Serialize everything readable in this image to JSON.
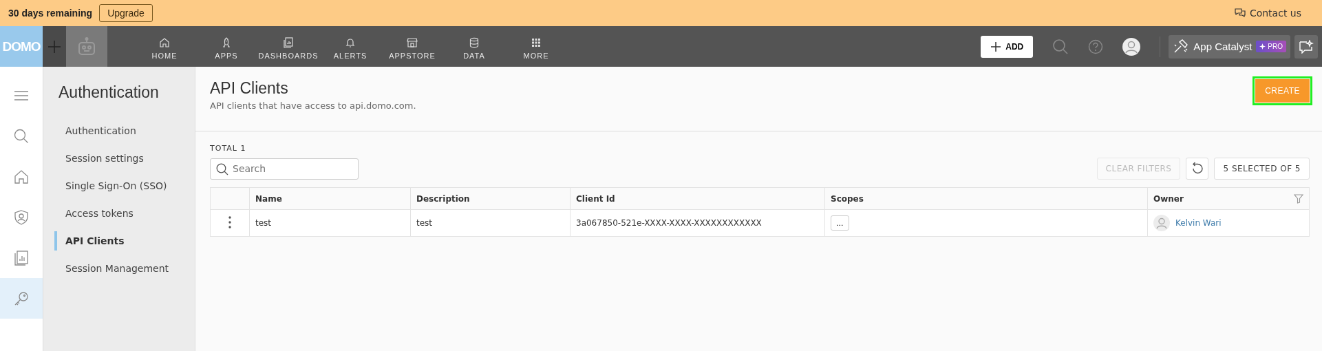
{
  "banner": {
    "trial_text": "30 days remaining",
    "upgrade_button": "Upgrade",
    "contact_link": "Contact us"
  },
  "topnav": {
    "logo": "DOMO",
    "items": [
      {
        "label": "HOME"
      },
      {
        "label": "APPS"
      },
      {
        "label": "DASHBOARDS"
      },
      {
        "label": "ALERTS"
      },
      {
        "label": "APPSTORE"
      },
      {
        "label": "DATA"
      },
      {
        "label": "MORE"
      }
    ],
    "add_button": "ADD",
    "app_catalyst": {
      "label": "App Catalyst",
      "badge": "PRO"
    }
  },
  "rail": [
    {
      "selected": false
    },
    {
      "selected": false
    },
    {
      "selected": false
    },
    {
      "selected": false
    },
    {
      "selected": false
    },
    {
      "selected": true
    }
  ],
  "subnav": {
    "title": "Authentication",
    "items": [
      {
        "label": "Authentication",
        "selected": false
      },
      {
        "label": "Session settings",
        "selected": false
      },
      {
        "label": "Single Sign-On (SSO)",
        "selected": false
      },
      {
        "label": "Access tokens",
        "selected": false
      },
      {
        "label": "API Clients",
        "selected": true
      },
      {
        "label": "Session Management",
        "selected": false
      }
    ]
  },
  "page": {
    "title": "API Clients",
    "subtitle": "API clients that have access to api.domo.com.",
    "create_button": "CREATE"
  },
  "toolbar": {
    "total": "TOTAL 1",
    "search": {
      "placeholder": "Search"
    },
    "clear_filters": {
      "label": "CLEAR FILTERS",
      "disabled": true
    },
    "selection_button": "5 SELECTED OF 5"
  },
  "table": {
    "columns": [
      "Name",
      "Description",
      "Client Id",
      "Scopes",
      "Owner"
    ],
    "rows": [
      {
        "name": "test",
        "description": "test",
        "client_id": "3a067850-521e-XXXX-XXXX-XXXXXXXXXXXX",
        "scopes_button": "...",
        "owner": "Kelvin Wari"
      }
    ]
  }
}
